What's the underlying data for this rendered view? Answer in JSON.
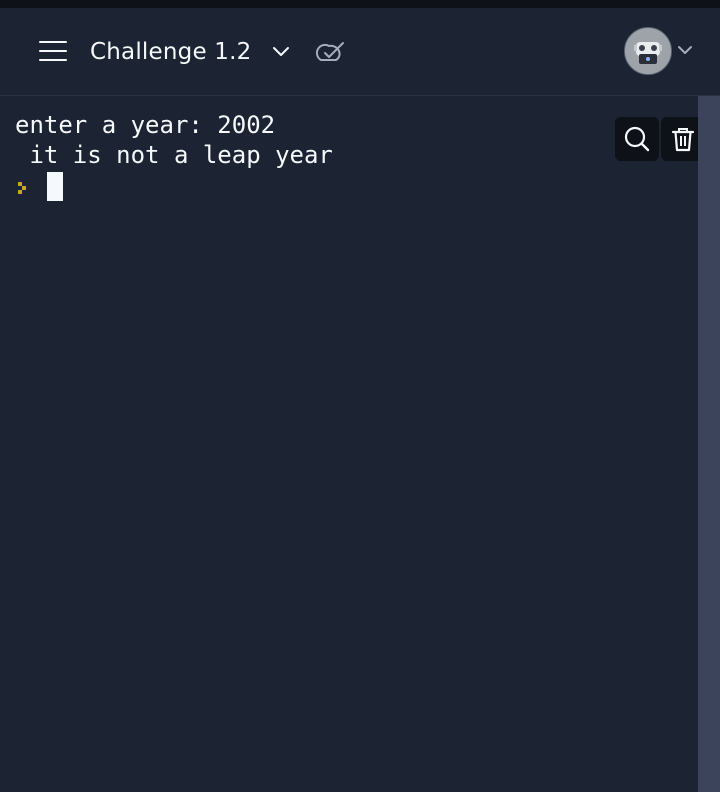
{
  "header": {
    "title": "Challenge 1.2",
    "menu_icon": "hamburger-icon",
    "title_dropdown_icon": "chevron-down-icon",
    "sync_icon": "cloud-check-icon",
    "avatar_icon": "robot-avatar",
    "avatar_dropdown_icon": "chevron-down-icon"
  },
  "console": {
    "lines": [
      "enter a year: 2002",
      " it is not a leap year"
    ],
    "prompt_icon": "prompt-chevron-icon",
    "prompt_color": "#c4a828",
    "search_icon": "search-icon",
    "clear_icon": "trash-icon"
  },
  "colors": {
    "background": "#1c2333",
    "text": "#f5f9fc",
    "button_bg": "#0e1117",
    "scrollbar": "#3c445c"
  }
}
